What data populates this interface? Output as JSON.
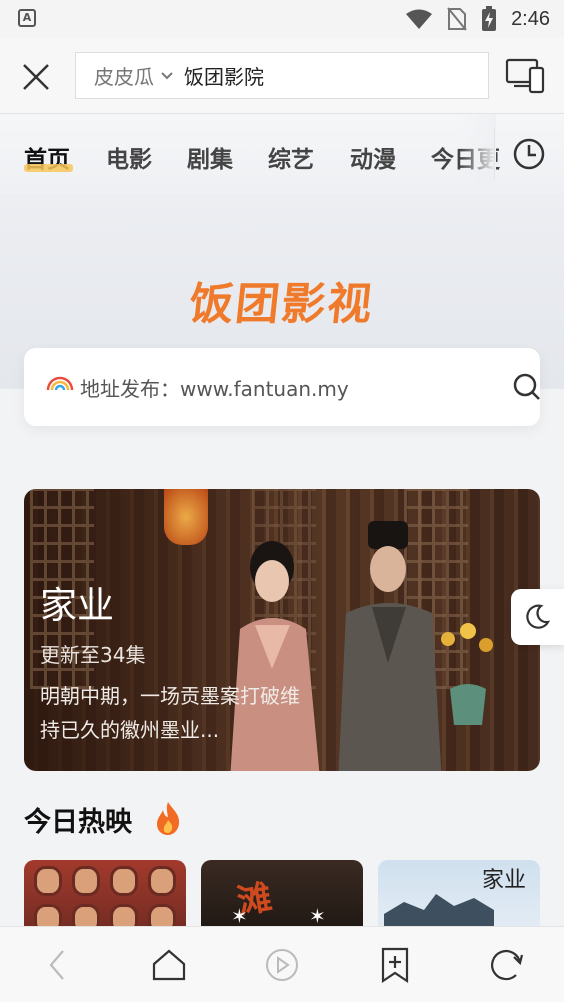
{
  "status_bar": {
    "time": "2:46",
    "app_badge": "A"
  },
  "browser": {
    "search_engine": "皮皮瓜",
    "query": "饭团影院"
  },
  "tabs": [
    "首页",
    "电影",
    "剧集",
    "综艺",
    "动漫",
    "今日更"
  ],
  "active_tab": "首页",
  "site": {
    "logo_text": "饭团影视",
    "address_text": "地址发布：www.fantuan.my"
  },
  "banner": {
    "title": "家业",
    "episodes": "更新至34集",
    "description": "明朝中期，一场贡墨案打破维持已久的徽州墨业..."
  },
  "section": {
    "title": "今日热映",
    "thumb2_text": "滩",
    "thumb3_text": "家业"
  },
  "colors": {
    "accent": "#f07a2b",
    "tab_underline": "#f7c75a"
  },
  "icons": {
    "close": "close-icon",
    "devices": "devices-icon",
    "history": "clock-icon",
    "search": "search-icon",
    "night": "moon-icon",
    "back": "back-icon",
    "home": "home-icon",
    "play": "play-icon",
    "bookmark": "bookmark-add-icon",
    "refresh": "refresh-icon"
  }
}
